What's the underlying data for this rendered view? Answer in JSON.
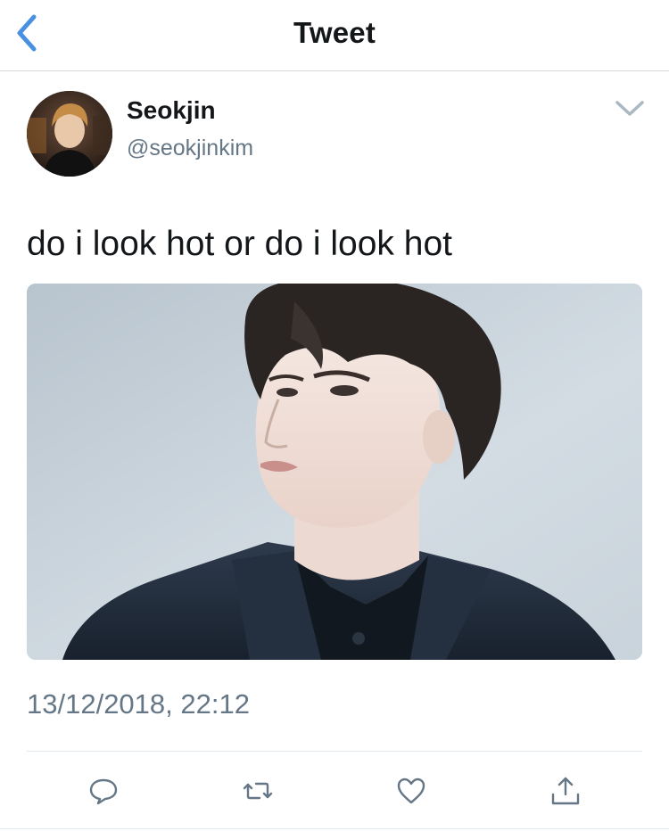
{
  "nav": {
    "title": "Tweet",
    "back_icon": "chevron-left-icon"
  },
  "tweet": {
    "author_name": "Seokjin",
    "author_handle": "@seokjinkim",
    "text": "do i look hot or do i look hot",
    "timestamp": "13/12/2018, 22:12"
  },
  "actions": [
    {
      "name": "reply",
      "icon": "reply-icon"
    },
    {
      "name": "retweet",
      "icon": "retweet-icon"
    },
    {
      "name": "like",
      "icon": "heart-icon"
    },
    {
      "name": "share",
      "icon": "share-icon"
    }
  ],
  "colors": {
    "accent": "#4a90e2",
    "text": "#14171a",
    "secondary": "#657786",
    "divider": "#e1e8ed"
  }
}
